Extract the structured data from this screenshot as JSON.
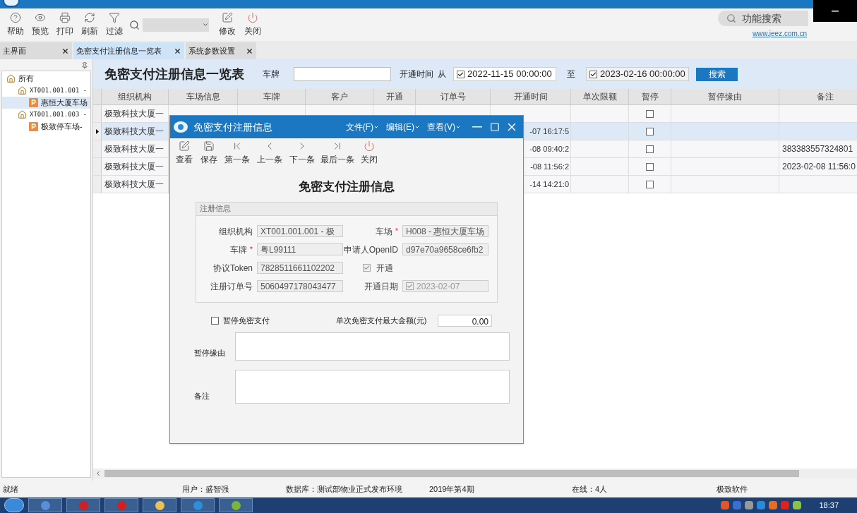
{
  "toolbar": [
    {
      "label": "帮助"
    },
    {
      "label": "预览"
    },
    {
      "label": "打印"
    },
    {
      "label": "刷新"
    },
    {
      "label": "过滤"
    }
  ],
  "toolbar_right": [
    {
      "label": "修改"
    },
    {
      "label": "关闭"
    }
  ],
  "function_search": {
    "placeholder": "功能搜索"
  },
  "website_link": "www.jeez.com.cn",
  "tabs": [
    {
      "label": "主界面",
      "selected": false
    },
    {
      "label": "免密支付注册信息一览表",
      "selected": true
    },
    {
      "label": "系统参数设置",
      "selected": false
    }
  ],
  "tree": [
    {
      "label": "所有",
      "kind": "home",
      "selected": false,
      "children": [
        {
          "label": "XT001.001.001 -",
          "kind": "home",
          "selected": false,
          "children": [
            {
              "label": "惠恒大厦车场",
              "kind": "parking",
              "selected": true
            }
          ]
        },
        {
          "label": "XT001.001.003 -",
          "kind": "home",
          "selected": false,
          "children": [
            {
              "label": "极致停车场-",
              "kind": "parking",
              "selected": false
            }
          ]
        }
      ]
    }
  ],
  "page_title": "免密支付注册信息一览表",
  "filter": {
    "plate_label": "车牌",
    "time_label": "开通时间",
    "from_label": "从",
    "from": {
      "checked": true,
      "value": "2022-11-15 00:00:00"
    },
    "to_label": "至",
    "to": {
      "checked": true,
      "value": "2023-02-16 00:00:00"
    },
    "search_button": "搜索"
  },
  "table": {
    "columns": [
      "组织机构",
      "车场信息",
      "车牌",
      "客户",
      "开通",
      "订单号",
      "开通时间",
      "单次限额",
      "暂停",
      "暂停缘由",
      "备注"
    ],
    "rows": [
      {
        "selected": false,
        "org": "极致科技大厦一",
        "paused": false
      },
      {
        "selected": true,
        "org": "极致科技大厦一",
        "time": "-07 16:17:5",
        "paused": false
      },
      {
        "selected": false,
        "org": "极致科技大厦一",
        "time": "-08 09:40:2",
        "paused": false,
        "remark": "383383557324801"
      },
      {
        "selected": false,
        "org": "极致科技大厦一",
        "time": "-08 11:56:2",
        "paused": false,
        "remark": "2023-02-08 11:56:0"
      },
      {
        "selected": false,
        "org": "极致科技大厦一",
        "time": "-14 14:21:0",
        "paused": false
      }
    ]
  },
  "dialog": {
    "title": "免密支付注册信息",
    "menus": [
      "文件(F)",
      "编辑(E)",
      "查看(V)"
    ],
    "toolbar": [
      {
        "label": "查看"
      },
      {
        "label": "保存"
      },
      {
        "label": "第一条"
      },
      {
        "label": "上一条"
      },
      {
        "label": "下一条"
      },
      {
        "label": "最后一条"
      },
      {
        "label": "关闭"
      }
    ],
    "heading": "免密支付注册信息",
    "group_title": "注册信息",
    "fields": [
      {
        "kind": "text",
        "label": "组织机构",
        "value": "XT001.001.001  - 极"
      },
      {
        "kind": "text",
        "label": "车场",
        "required_mark": "*",
        "value": "H008 - 惠恒大厦车场"
      },
      {
        "kind": "text",
        "label": "车牌",
        "required_mark": "*",
        "value": "粤L99111"
      },
      {
        "kind": "text",
        "label": "申请人OpenID",
        "value": "d97e70a9658ce6fb2"
      },
      {
        "kind": "text",
        "label": "协议Token",
        "value": "7828511661102202"
      },
      {
        "kind": "checkbox",
        "label": "开通",
        "checked": true
      },
      {
        "kind": "text",
        "label": "注册订单号",
        "value": "5060497178043477"
      },
      {
        "kind": "date",
        "label": "开通日期",
        "checked": true,
        "value": "2023-02-07"
      }
    ],
    "pause": {
      "label": "暂停免密支付",
      "checked": false
    },
    "max_amount": {
      "label": "单次免密支付最大金额(元)",
      "value": "0.00"
    },
    "pause_reason_label": "暂停缘由",
    "remark_label": "备注"
  },
  "status_bar": [
    "就绪",
    "用户：盛智强",
    "数据库：测试部物业正式发布环境",
    "2019年第4期",
    "在线：4人",
    "极致软件"
  ],
  "taskbar": {
    "time": "18:37"
  }
}
